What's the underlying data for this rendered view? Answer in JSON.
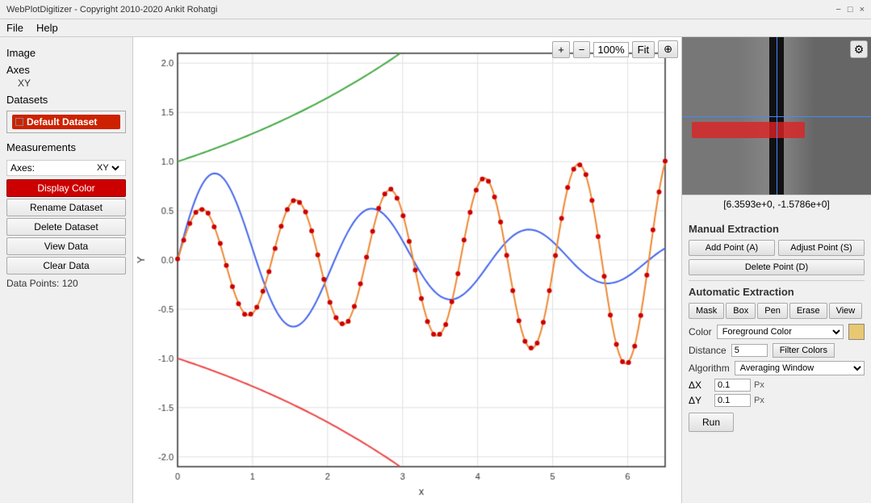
{
  "titlebar": {
    "title": "WebPlotDigitizer - Copyright 2010-2020 Ankit Rohatgi",
    "controls": [
      "−",
      "□",
      "×"
    ]
  },
  "menubar": {
    "items": [
      "File",
      "Help"
    ]
  },
  "sidebar": {
    "image_label": "Image",
    "axes_label": "Axes",
    "axes_type": "XY",
    "datasets_label": "Datasets",
    "dataset_section_label": "Dataset",
    "dataset_name": "Default Dataset",
    "measurements_label": "Measurements",
    "axes_row_label": "Axes:",
    "axes_row_value": "XY",
    "btn_display_color": "Display Color",
    "btn_rename": "Rename Dataset",
    "btn_delete": "Delete Dataset",
    "btn_view_data": "View Data",
    "btn_clear_data": "Clear Data",
    "data_points_label": "Data Points: 120"
  },
  "toolbar": {
    "zoom_plus": "+",
    "zoom_minus": "−",
    "zoom_level": "100%",
    "zoom_fit": "Fit",
    "crosshair": "⊕"
  },
  "preview": {
    "settings_icon": "⚙",
    "coords": "[6.3593e+0, -1.5786e+0]"
  },
  "manual_extraction": {
    "title": "Manual Extraction",
    "btn_add_point": "Add Point (A)",
    "btn_adjust_point": "Adjust Point (S)",
    "btn_delete_point": "Delete Point (D)"
  },
  "automatic_extraction": {
    "title": "Automatic Extraction",
    "btn_mask": "Mask",
    "btn_box": "Box",
    "btn_pen": "Pen",
    "btn_erase": "Erase",
    "btn_view": "View",
    "color_label": "Color",
    "color_dropdown": "Foreground Color",
    "color_swatch_hex": "#e8c870",
    "distance_label": "Distance",
    "distance_value": "5",
    "btn_filter_colors": "Filter Colors",
    "algorithm_label": "Algorithm",
    "algorithm_value": "Averaging Window",
    "delta_x_label": "ΔX",
    "delta_x_value": "0.1",
    "delta_x_unit": "Px",
    "delta_y_label": "ΔY",
    "delta_y_value": "0.1",
    "delta_y_unit": "Px",
    "btn_run": "Run"
  },
  "chart": {
    "x_label": "x",
    "y_label": "Y",
    "x_ticks": [
      "0",
      "1",
      "2",
      "3",
      "4",
      "5",
      "6"
    ],
    "y_ticks": [
      "-2.0",
      "-1.5",
      "-1.0",
      "-0.5",
      "0.0",
      "0.5",
      "1.0",
      "1.5",
      "2.0"
    ]
  }
}
